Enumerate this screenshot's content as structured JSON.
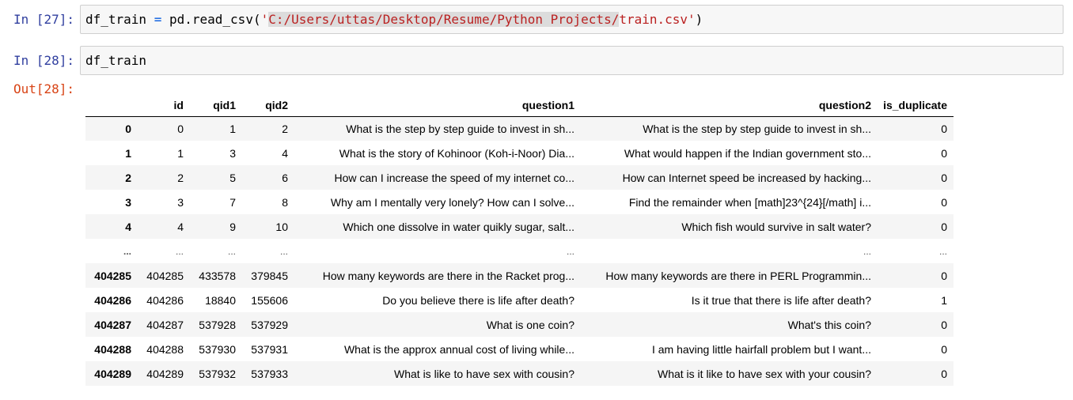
{
  "cells": [
    {
      "prompt": "In [27]:",
      "code": {
        "var": "df_train",
        "eq": "=",
        "call": "pd.read_csv(",
        "quote_open": "'",
        "path_highlighted": "C:/Users/uttas/Desktop/Resume/Python Projects/",
        "path_rest": "train.csv",
        "quote_close": "'",
        "close": ")"
      }
    },
    {
      "prompt": "In [28]:",
      "code_text": "df_train",
      "out_prompt": "Out[28]:"
    }
  ],
  "dataframe": {
    "columns": [
      "",
      "id",
      "qid1",
      "qid2",
      "question1",
      "question2",
      "is_duplicate"
    ],
    "rows": [
      [
        "0",
        "0",
        "1",
        "2",
        "What is the step by step guide to invest in sh...",
        "What is the step by step guide to invest in sh...",
        "0"
      ],
      [
        "1",
        "1",
        "3",
        "4",
        "What is the story of Kohinoor (Koh-i-Noor) Dia...",
        "What would happen if the Indian government sto...",
        "0"
      ],
      [
        "2",
        "2",
        "5",
        "6",
        "How can I increase the speed of my internet co...",
        "How can Internet speed be increased by hacking...",
        "0"
      ],
      [
        "3",
        "3",
        "7",
        "8",
        "Why am I mentally very lonely? How can I solve...",
        "Find the remainder when [math]23^{24}[/math] i...",
        "0"
      ],
      [
        "4",
        "4",
        "9",
        "10",
        "Which one dissolve in water quikly sugar, salt...",
        "Which fish would survive in salt water?",
        "0"
      ],
      [
        "...",
        "...",
        "...",
        "...",
        "...",
        "...",
        "..."
      ],
      [
        "404285",
        "404285",
        "433578",
        "379845",
        "How many keywords are there in the Racket prog...",
        "How many keywords are there in PERL Programmin...",
        "0"
      ],
      [
        "404286",
        "404286",
        "18840",
        "155606",
        "Do you believe there is life after death?",
        "Is it true that there is life after death?",
        "1"
      ],
      [
        "404287",
        "404287",
        "537928",
        "537929",
        "What is one coin?",
        "What's this coin?",
        "0"
      ],
      [
        "404288",
        "404288",
        "537930",
        "537931",
        "What is the approx annual cost of living while...",
        "I am having little hairfall problem but I want...",
        "0"
      ],
      [
        "404289",
        "404289",
        "537932",
        "537933",
        "What is like to have sex with cousin?",
        "What is it like to have sex with your cousin?",
        "0"
      ]
    ]
  }
}
